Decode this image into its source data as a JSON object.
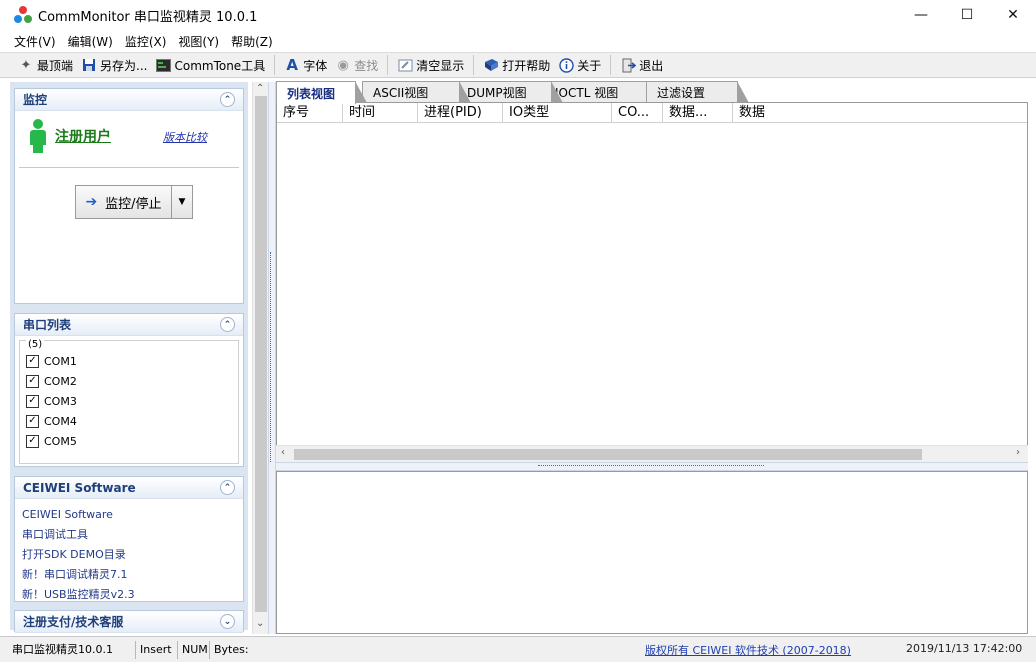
{
  "window": {
    "title": "CommMonitor 串口监视精灵 10.0.1"
  },
  "menu": [
    "文件(V)",
    "编辑(W)",
    "监控(X)",
    "视图(Y)",
    "帮助(Z)"
  ],
  "toolbar": {
    "topmost": "最顶端",
    "save_as": "另存为...",
    "commtone": "CommTone工具",
    "font": "字体",
    "find": "查找",
    "clear": "清空显示",
    "help": "打开帮助",
    "about": "关于",
    "exit": "退出"
  },
  "monitor_panel": {
    "title": "监控",
    "register_user": "注册用户",
    "version_compare": "版本比较",
    "start_stop": "监控/停止"
  },
  "port_panel": {
    "title": "串口列表",
    "count": "(5)",
    "ports": [
      "COM1",
      "COM2",
      "COM3",
      "COM4",
      "COM5"
    ]
  },
  "vendor_panel": {
    "title": "CEIWEI Software",
    "links": [
      "CEIWEI Software",
      "串口调试工具",
      "打开SDK DEMO目录",
      "新！串口调试精灵7.1",
      "新！USB监控精灵v2.3"
    ]
  },
  "support_panel": {
    "title": "注册支付/技术客服"
  },
  "tabs": [
    "列表视图",
    "ASCII视图",
    "DUMP视图",
    "IOCTL 视图",
    "过滤设置"
  ],
  "columns": [
    "序号",
    "时间",
    "进程(PID)",
    "IO类型",
    "CO...",
    "数据...",
    "数据"
  ],
  "status": {
    "app": "串口监视精灵10.0.1",
    "insert": "Insert",
    "num": "NUM",
    "bytes": "Bytes:",
    "copyright": "版权所有 CEIWEI 软件技术 (2007-2018)",
    "datetime": "2019/11/13 17:42:00"
  }
}
